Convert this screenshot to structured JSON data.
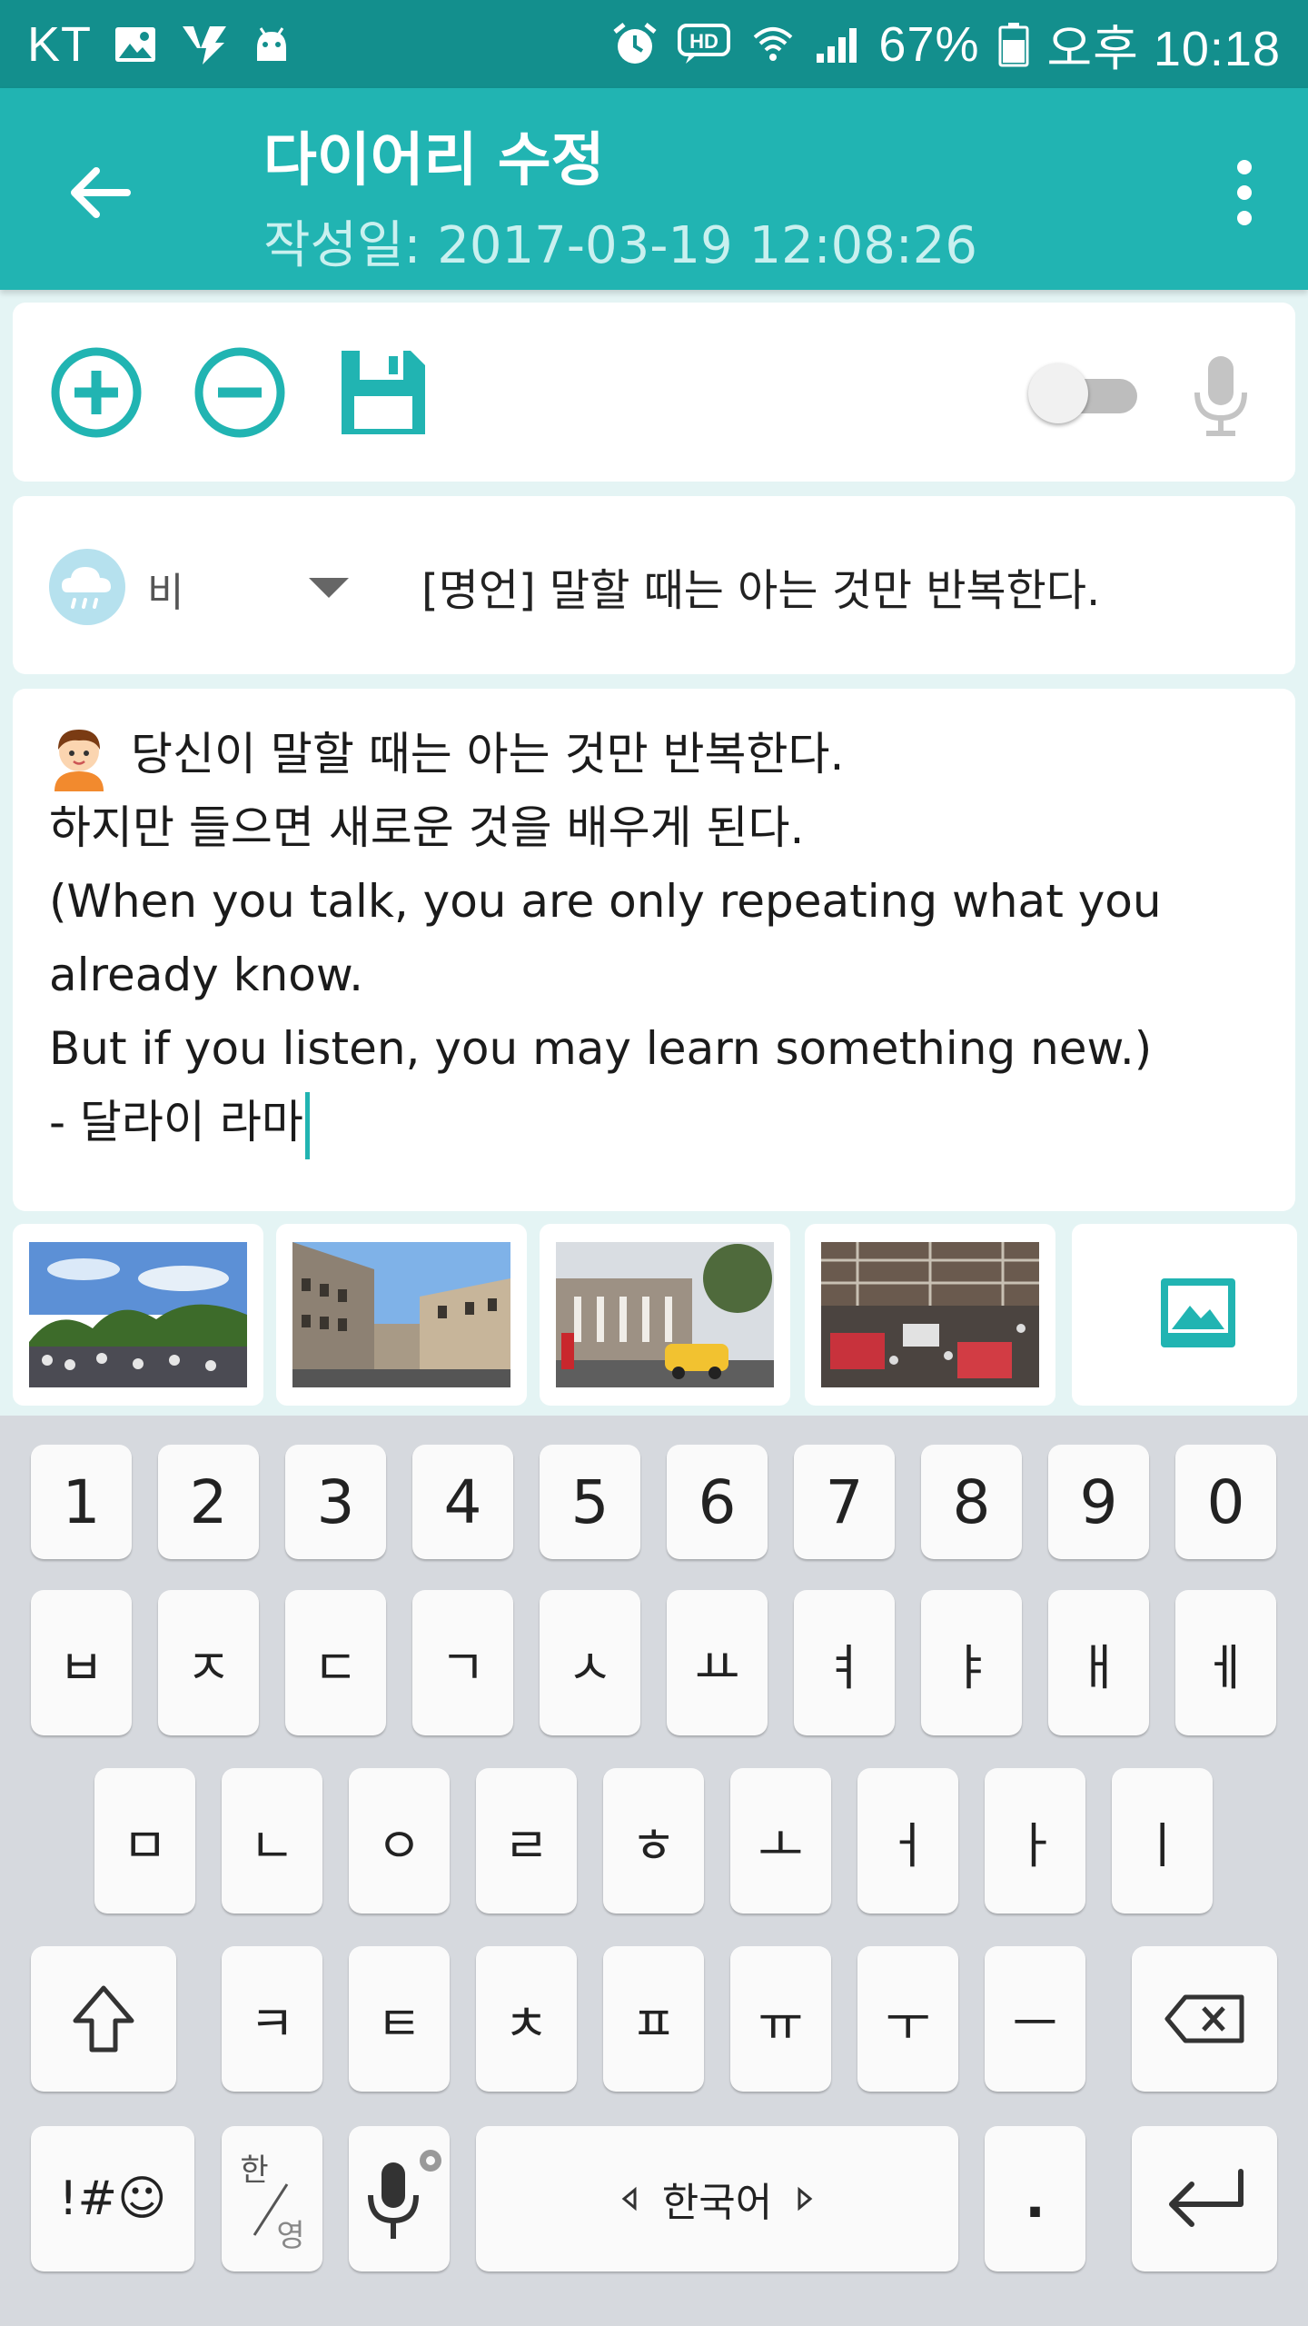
{
  "status_bar": {
    "carrier": "KT",
    "battery": "67%",
    "time": "오후 10:18",
    "hd_label": "HD",
    "icons": [
      "image-icon",
      "vaccine-icon",
      "android-icon",
      "alarm-icon",
      "hd-voice-icon",
      "wifi-icon",
      "signal-icon",
      "battery-icon"
    ]
  },
  "app_bar": {
    "title": "다이어리 수정",
    "subtitle": "작성일: 2017-03-19 12:08:26",
    "back_icon": "arrow-left-icon",
    "menu_icon": "more-vertical-icon"
  },
  "toolbar": {
    "icons": [
      "plus-circle-icon",
      "minus-circle-icon",
      "save-icon"
    ],
    "voice_toggle_on": false,
    "mic_icon": "mic-icon"
  },
  "entry_header": {
    "weather_label": "비",
    "weather_icon": "rain-cloud-icon",
    "quote": "[명언] 말할 때는 아는 것만 반복한다."
  },
  "entry_body": {
    "lines": [
      "당신이 말할 때는 아는 것만 반복한다.",
      "하지만 들으면 새로운 것을 배우게 된다.",
      "(When you talk, you are only repeating what you",
      "already know.",
      "But if you listen, you may learn something new.)",
      "- 달라이 라마"
    ],
    "avatar_icon": "boy-avatar-icon"
  },
  "photos": {
    "items": [
      "photo-buckingham-palace-crowd",
      "photo-regent-street",
      "photo-london-taxi-street",
      "photo-indoor-market-hall"
    ],
    "add_icon": "add-image-icon"
  },
  "keyboard": {
    "row1": [
      "1",
      "2",
      "3",
      "4",
      "5",
      "6",
      "7",
      "8",
      "9",
      "0"
    ],
    "row2": [
      "ㅂ",
      "ㅈ",
      "ㄷ",
      "ㄱ",
      "ㅅ",
      "ㅛ",
      "ㅕ",
      "ㅑ",
      "ㅐ",
      "ㅔ"
    ],
    "row3": [
      "ㅁ",
      "ㄴ",
      "ㅇ",
      "ㄹ",
      "ㅎ",
      "ㅗ",
      "ㅓ",
      "ㅏ",
      "ㅣ"
    ],
    "row4": [
      "ㅋ",
      "ㅌ",
      "ㅊ",
      "ㅍ",
      "ㅠ",
      "ㅜ",
      "ㅡ"
    ],
    "symbols_key": "!#☺",
    "lang_toggle_top": "한",
    "lang_toggle_bottom": "영",
    "space_label": "한국어",
    "period_key": "."
  },
  "colors": {
    "status_bar": "#138f8d",
    "app_bar": "#21b4b2",
    "accent": "#21b4b2",
    "background": "#e4f4f4",
    "keyboard": "#d6d9de"
  }
}
